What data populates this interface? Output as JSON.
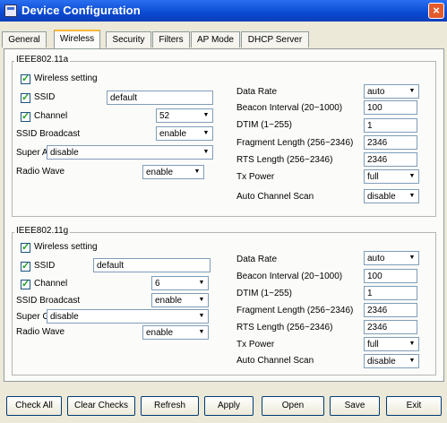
{
  "window": {
    "title": "Device Configuration",
    "close": "×"
  },
  "tabs": [
    "General",
    "Wireless",
    "Security",
    "Filters",
    "AP Mode",
    "DHCP Server"
  ],
  "active_tab": "Wireless",
  "group_a": {
    "legend": "IEEE802.11a",
    "wireless_setting": "Wireless setting",
    "ssid_label": "SSID",
    "ssid_value": "default",
    "channel_label": "Channel",
    "channel_value": "52",
    "ssid_broadcast_label": "SSID Broadcast",
    "ssid_broadcast_value": "enable",
    "super_label": "Super A",
    "super_value": "disable",
    "radio_wave_label": "Radio Wave",
    "radio_wave_value": "enable",
    "data_rate_label": "Data Rate",
    "data_rate_value": "auto",
    "beacon_label": "Beacon Interval (20~1000)",
    "beacon_value": "100",
    "dtim_label": "DTIM (1~255)",
    "dtim_value": "1",
    "fragment_label": "Fragment Length (256~2346)",
    "fragment_value": "2346",
    "rts_label": "RTS Length (256~2346)",
    "rts_value": "2346",
    "tx_power_label": "Tx Power",
    "tx_power_value": "full",
    "auto_channel_label": "Auto Channel Scan",
    "auto_channel_value": "disable"
  },
  "group_g": {
    "legend": "IEEE802.11g",
    "wireless_setting": "Wireless setting",
    "ssid_label": "SSID",
    "ssid_value": "default",
    "channel_label": "Channel",
    "channel_value": "6",
    "ssid_broadcast_label": "SSID Broadcast",
    "ssid_broadcast_value": "enable",
    "super_label": "Super G",
    "super_value": "disable",
    "radio_wave_label": "Radio Wave",
    "radio_wave_value": "enable",
    "data_rate_label": "Data Rate",
    "data_rate_value": "auto",
    "beacon_label": "Beacon Interval (20~1000)",
    "beacon_value": "100",
    "dtim_label": "DTIM (1~255)",
    "dtim_value": "1",
    "fragment_label": "Fragment Length (256~2346)",
    "fragment_value": "2346",
    "rts_label": "RTS Length (256~2346)",
    "rts_value": "2346",
    "tx_power_label": "Tx Power",
    "tx_power_value": "full",
    "auto_channel_label": "Auto Channel Scan",
    "auto_channel_value": "disable"
  },
  "buttons": [
    "Check All",
    "Clear Checks",
    "Refresh",
    "Apply",
    "Open",
    "Save",
    "Exit"
  ]
}
